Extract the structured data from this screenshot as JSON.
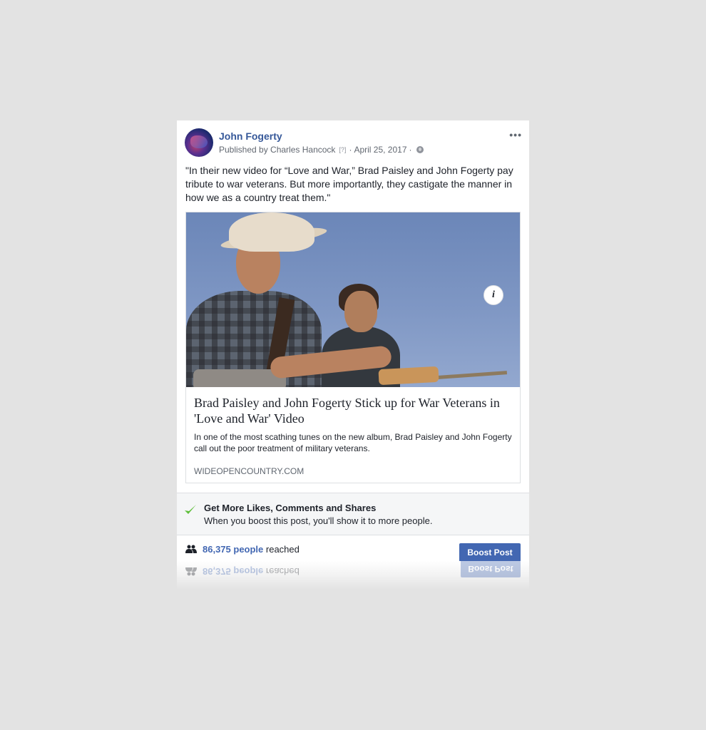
{
  "post": {
    "page_name": "John Fogerty",
    "published_by": "Published by Charles Hancock",
    "help_mark": "[?]",
    "separator": "·",
    "date": "April 25, 2017",
    "privacy_icon": "globe-icon",
    "more_label": "•••",
    "caption": "\"In their new video for “Love and War,” Brad Paisley and John Fogerty pay tribute to war veterans. But more importantly, they castigate the manner in how we as a country treat them.\""
  },
  "link": {
    "info_label": "i",
    "title": "Brad Paisley and John Fogerty Stick up for War Veterans in 'Love and War' Video",
    "description": "In one of the most scathing tunes on the new album, Brad Paisley and John Fogerty call out the poor treatment of military veterans.",
    "domain": "WIDEOPENCOUNTRY.COM"
  },
  "promo": {
    "title": "Get More Likes, Comments and Shares",
    "subtitle": "When you boost this post, you'll show it to more people.",
    "check_color": "#5fbf3b"
  },
  "footer": {
    "reach_count": "86,375 people",
    "reach_suffix": " reached",
    "boost_label": "Boost Post"
  },
  "colors": {
    "link_blue": "#365899",
    "brand_blue": "#4267b2",
    "background": "#e3e3e3"
  }
}
